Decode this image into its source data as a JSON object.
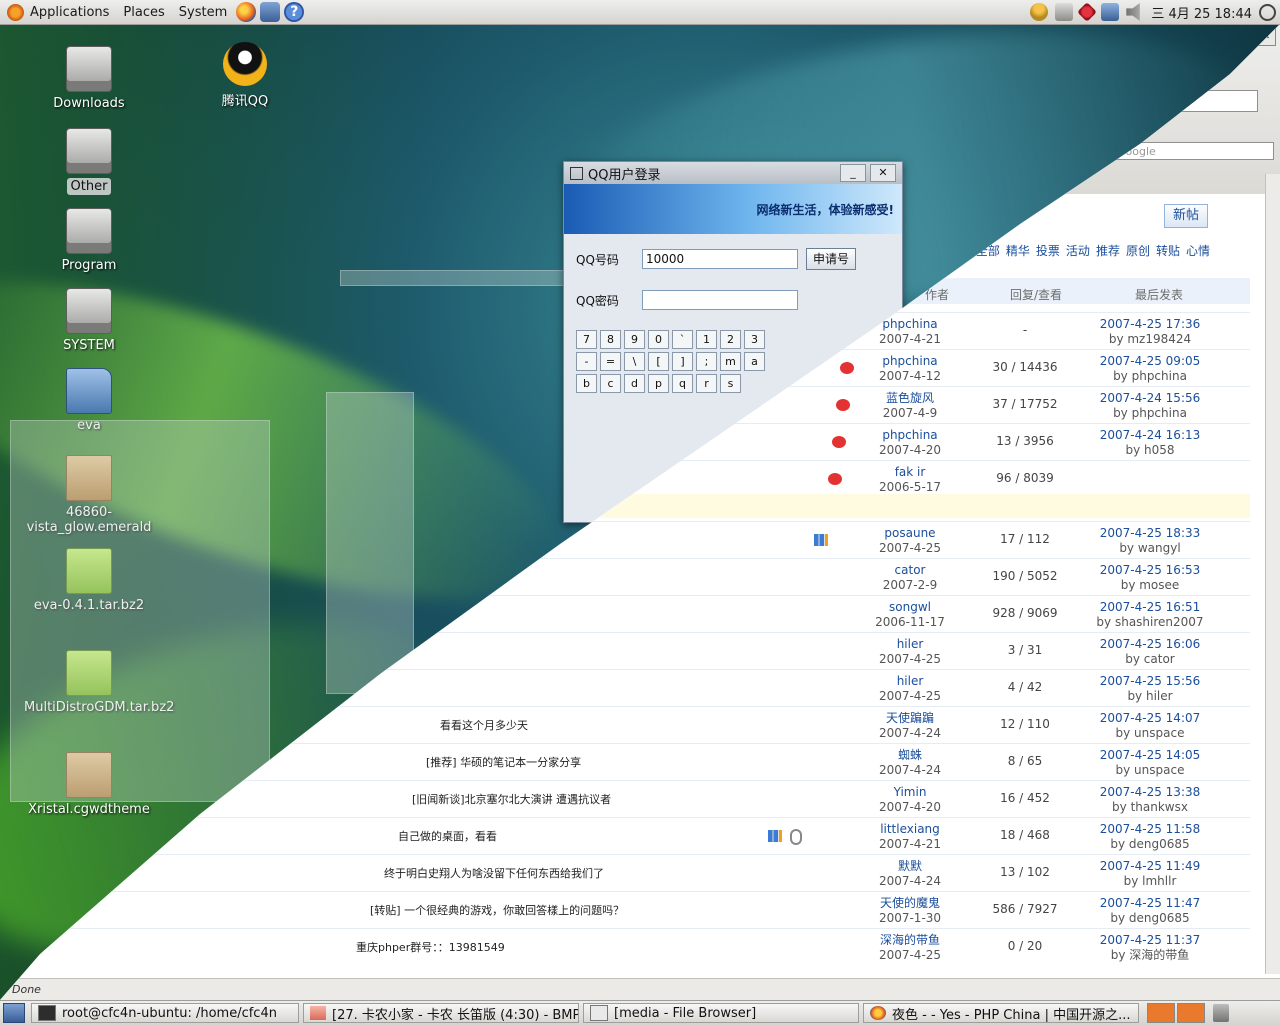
{
  "top_panel": {
    "menus": [
      "Applications",
      "Places",
      "System"
    ],
    "clock": "三 4月 25 18:44"
  },
  "desktop_icons": [
    {
      "label": "Downloads",
      "icon": "drive-icon"
    },
    {
      "label": "腾讯QQ",
      "icon": "qq-penguin-icon"
    },
    {
      "label": "Other",
      "icon": "drive-icon"
    },
    {
      "label": "Program",
      "icon": "drive-icon"
    },
    {
      "label": "SYSTEM",
      "icon": "drive-icon"
    },
    {
      "label": "eva",
      "icon": "folder-icon"
    },
    {
      "label": "46860-vista_glow.emerald",
      "icon": "package-icon"
    },
    {
      "label": "eva-0.4.1.tar.bz2",
      "icon": "archive-icon"
    },
    {
      "label": "MultiDistroGDM.tar.bz2",
      "icon": "archive-icon"
    },
    {
      "label": "Xristal.cgwdtheme",
      "icon": "package-icon"
    }
  ],
  "qq_login": {
    "title": "QQ用户登录",
    "banner": "网络新生活，体验新感受!",
    "number_label": "QQ号码",
    "number_value": "10000",
    "apply_button": "申请号",
    "password_label": "QQ密码",
    "keys": [
      "7",
      "8",
      "9",
      "0",
      "`",
      "1",
      "2",
      "3",
      "-",
      "=",
      "\\",
      "[",
      "]",
      ";",
      "m",
      "a",
      "b",
      "c",
      "d",
      "p",
      "q",
      "r",
      "s"
    ]
  },
  "browser": {
    "search_placeholder": "Google",
    "new_post_button": "新帖",
    "board_links": [
      "全部",
      "精华",
      "投票",
      "活动",
      "推荐",
      "原创",
      "转贴",
      "心情"
    ],
    "columns": {
      "author": "作者",
      "replies": "回复/查看",
      "last": "最后发表"
    },
    "status": "Done",
    "threads": [
      {
        "author": "phpchina",
        "date": "2007-4-21",
        "replies": "-",
        "last_date": "2007-4-25 17:36",
        "last_by": "by mz198424",
        "topic": ""
      },
      {
        "author": "phpchina",
        "date": "2007-4-12",
        "replies": "30 / 14436",
        "last_date": "2007-4-25 09:05",
        "last_by": "by phpchina",
        "topic": ""
      },
      {
        "author": "蓝色旋风",
        "date": "2007-4-9",
        "replies": "37 / 17752",
        "last_date": "2007-4-24 15:56",
        "last_by": "by phpchina",
        "topic": ""
      },
      {
        "author": "phpchina",
        "date": "2007-4-20",
        "replies": "13 / 3956",
        "last_date": "2007-4-24 16:13",
        "last_by": "by h058",
        "topic": ""
      },
      {
        "author": "fak ir",
        "date": "2006-5-17",
        "replies": "96 / 8039",
        "last_date": "",
        "last_by": "",
        "topic": ""
      },
      {
        "author": "posaune",
        "date": "2007-4-25",
        "replies": "17 / 112",
        "last_date": "2007-4-25 18:33",
        "last_by": "by wangyl",
        "topic": ""
      },
      {
        "author": "cator",
        "date": "2007-2-9",
        "replies": "190 / 5052",
        "last_date": "2007-4-25 16:53",
        "last_by": "by mosee",
        "topic": ""
      },
      {
        "author": "songwl",
        "date": "2006-11-17",
        "replies": "928 / 9069",
        "last_date": "2007-4-25 16:51",
        "last_by": "by shashiren2007",
        "topic": ""
      },
      {
        "author": "hiler",
        "date": "2007-4-25",
        "replies": "3 / 31",
        "last_date": "2007-4-25 16:06",
        "last_by": "by cator",
        "topic": ""
      },
      {
        "author": "hiler",
        "date": "2007-4-25",
        "replies": "4 / 42",
        "last_date": "2007-4-25 15:56",
        "last_by": "by hiler",
        "topic": ""
      },
      {
        "author": "天使蹁蹁",
        "date": "2007-4-24",
        "replies": "12 / 110",
        "last_date": "2007-4-25 14:07",
        "last_by": "by unspace",
        "topic": "看看这个月多少天"
      },
      {
        "author": "蜘蛛",
        "date": "2007-4-24",
        "replies": "8 / 65",
        "last_date": "2007-4-25 14:05",
        "last_by": "by unspace",
        "topic": "[推荐] 华硕的笔记本一分家分享"
      },
      {
        "author": "Yimin",
        "date": "2007-4-20",
        "replies": "16 / 452",
        "last_date": "2007-4-25 13:38",
        "last_by": "by thankwsx",
        "topic": "[旧闻新谈]北京塞尔北大演讲 遭遇抗议者"
      },
      {
        "author": "littlexiang",
        "date": "2007-4-21",
        "replies": "18 / 468",
        "last_date": "2007-4-25 11:58",
        "last_by": "by deng0685",
        "topic": "自己做的桌面，看看"
      },
      {
        "author": "默默",
        "date": "2007-4-24",
        "replies": "13 / 102",
        "last_date": "2007-4-25 11:49",
        "last_by": "by lmhllr",
        "topic": "终于明白史翔人为啥没留下任何东西给我们了"
      },
      {
        "author": "天使的魔鬼",
        "date": "2007-1-30",
        "replies": "586 / 7927",
        "last_date": "2007-4-25 11:47",
        "last_by": "by deng0685",
        "topic": "[转贴] 一个很经典的游戏，你敢回答樣上的问题吗？"
      },
      {
        "author": "深海的带鱼",
        "date": "2007-4-25",
        "replies": "0 / 20",
        "last_date": "2007-4-25 11:37",
        "last_by": "by 深海的带鱼",
        "topic": "重庆phper群号：：13981549"
      }
    ]
  },
  "taskbar": [
    {
      "label": "root@cfc4n-ubuntu: /home/cfc4n",
      "icon": "terminal-icon"
    },
    {
      "label": "[27. 卡农小家 - 卡农 长笛版 (4:30) - BMP]",
      "icon": "media-player-icon"
    },
    {
      "label": "[media - File Browser]",
      "icon": "file-browser-icon"
    },
    {
      "label": "夜色 - - Yes - PHP China | 中国开源之...",
      "icon": "firefox-icon"
    }
  ]
}
